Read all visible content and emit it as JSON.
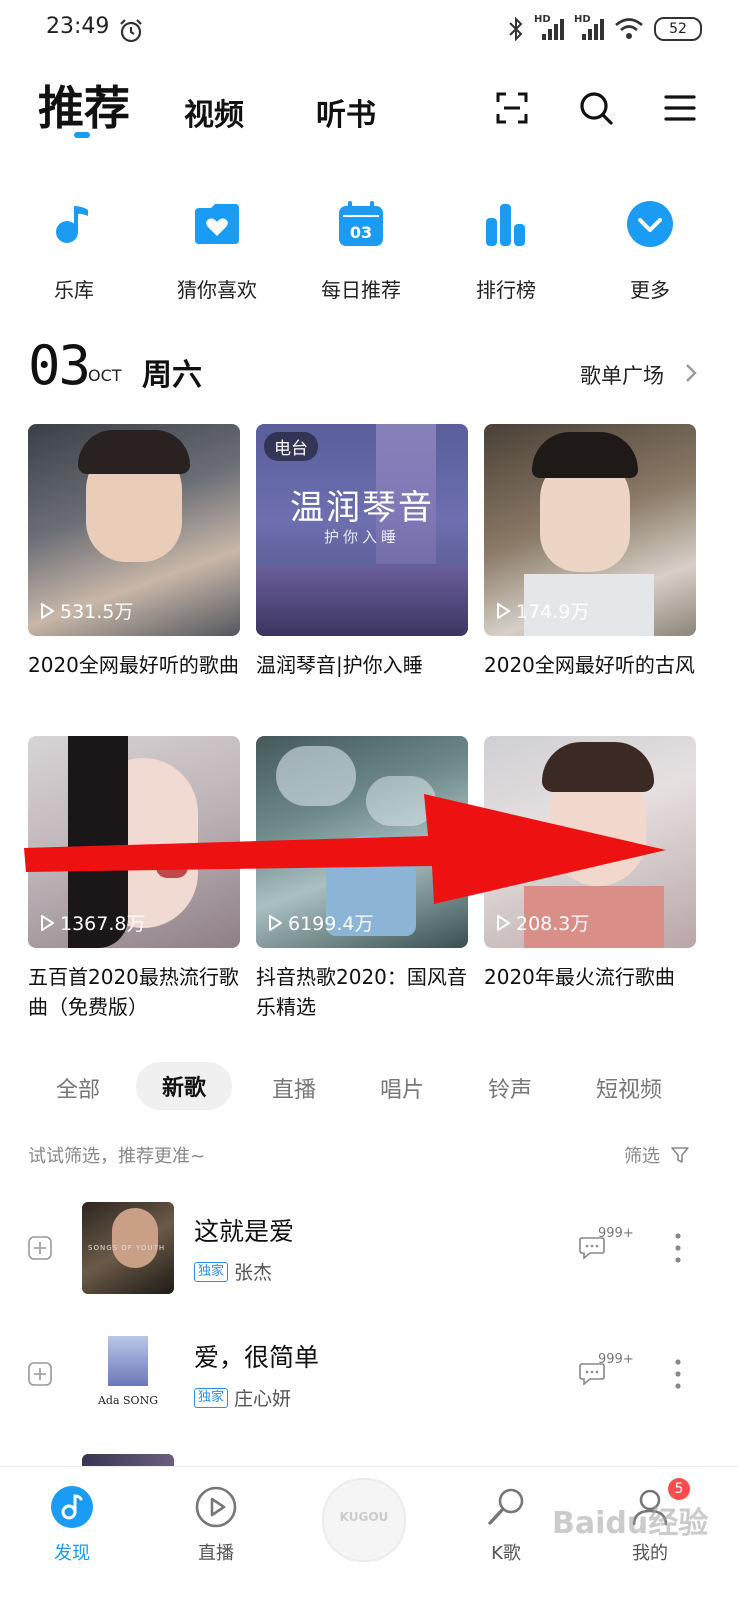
{
  "status_bar": {
    "time": "23:49",
    "battery": "52",
    "hd1": "HD",
    "hd2": "HD"
  },
  "top_tabs": {
    "recommend": "推荐",
    "video": "视频",
    "audiobook": "听书"
  },
  "quick_nav": [
    {
      "label": "乐库",
      "icon": "music-note-icon"
    },
    {
      "label": "猜你喜欢",
      "icon": "heart-folder-icon"
    },
    {
      "label": "每日推荐",
      "icon": "calendar-icon",
      "icon_text": "03"
    },
    {
      "label": "排行榜",
      "icon": "bar-chart-icon"
    },
    {
      "label": "更多",
      "icon": "chevron-down-circle-icon"
    }
  ],
  "date": {
    "day": "03",
    "month": "OCT",
    "weekday": "周六",
    "plaza": "歌单广场"
  },
  "playlists": [
    {
      "plays": "531.5万",
      "title": "2020全网最好听的歌曲"
    },
    {
      "plays": "",
      "title": "温润琴音|护你入睡",
      "tag": "电台",
      "cover_text": "温润琴音",
      "cover_sub": "护你入睡"
    },
    {
      "plays": "174.9万",
      "title": "2020全网最好听的古风"
    },
    {
      "plays": "1367.8万",
      "title": "五百首2020最热流行歌曲（免费版）"
    },
    {
      "plays": "6199.4万",
      "title": "抖音热歌2020：国风音乐精选"
    },
    {
      "plays": "208.3万",
      "title": "2020年最火流行歌曲"
    }
  ],
  "filter_tabs": [
    "全部",
    "新歌",
    "直播",
    "唱片",
    "铃声",
    "短视频"
  ],
  "filter": {
    "hint": "试试筛选，推荐更准~",
    "button": "筛选"
  },
  "songs": [
    {
      "title": "这就是爱",
      "badge": "独家",
      "artist": "张杰",
      "comments": "999+",
      "cover_text": "SONGS OF YOUTH"
    },
    {
      "title": "爱，很简单",
      "badge": "独家",
      "artist": "庄心妍",
      "comments": "999+",
      "cover_text": "Ada SONG"
    }
  ],
  "bottom_nav": {
    "discover": "发现",
    "live": "直播",
    "center": "KUGOU",
    "ksong": "K歌",
    "mine": "我的",
    "badge": "5"
  },
  "watermark": "Baidu经验",
  "colors": {
    "accent": "#1a9cf4",
    "arrow": "#ee1111",
    "badge": "#ff4d4d"
  }
}
